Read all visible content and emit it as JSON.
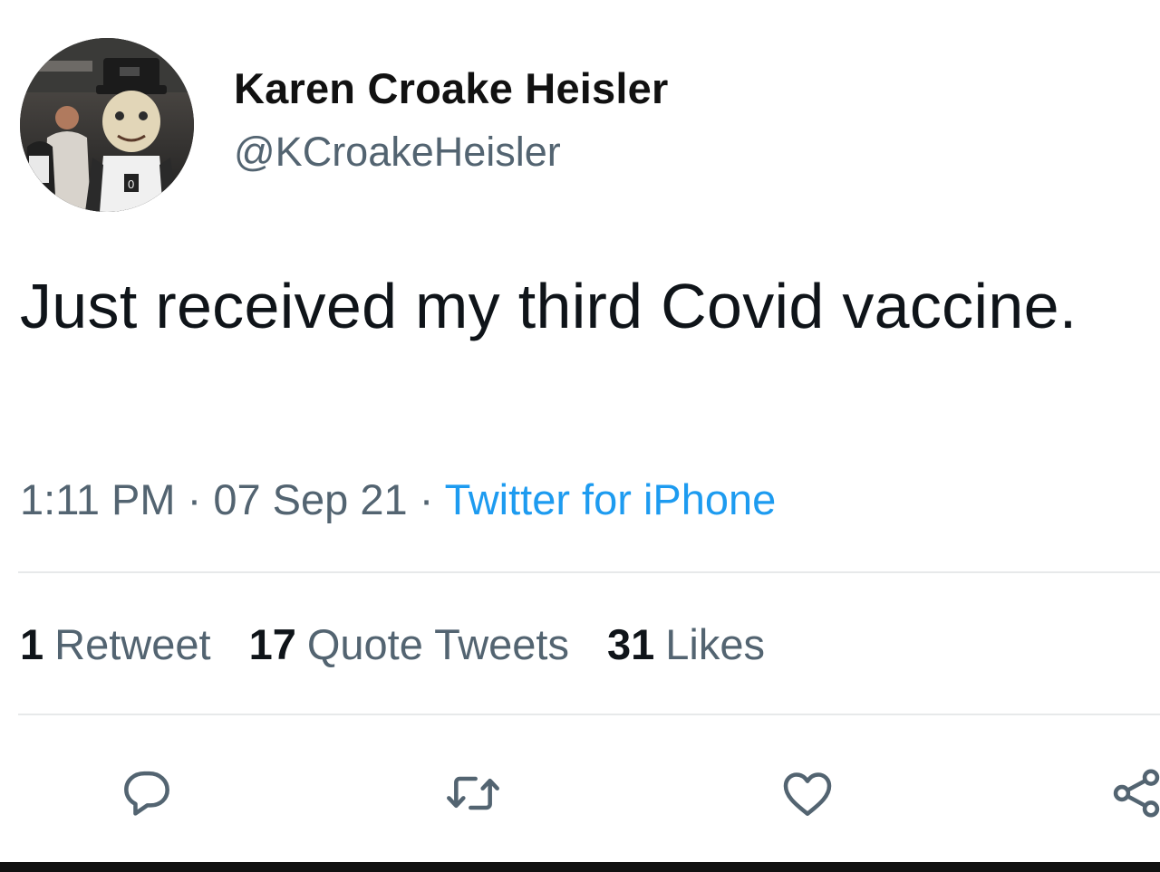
{
  "tweet": {
    "author": {
      "display_name": "Karen Croake Heisler",
      "handle": "@KCroakeHeisler",
      "avatar_icon": "mascot-avatar-image"
    },
    "text": "Just received my third Covid vaccine.",
    "meta": {
      "time": "1:11 PM",
      "separator": "·",
      "date": "07 Sep 21",
      "source": "Twitter for iPhone"
    },
    "stats": [
      {
        "count": "1",
        "label": "Retweet"
      },
      {
        "count": "17",
        "label": "Quote Tweets"
      },
      {
        "count": "31",
        "label": "Likes"
      }
    ],
    "actions": [
      {
        "name": "reply",
        "icon": "reply-icon"
      },
      {
        "name": "retweet",
        "icon": "retweet-icon"
      },
      {
        "name": "like",
        "icon": "heart-icon"
      },
      {
        "name": "share",
        "icon": "share-icon"
      }
    ]
  },
  "colors": {
    "text": "#0f1419",
    "secondary": "#536471",
    "link": "#1d9bf0",
    "divider": "#e7e9ea"
  }
}
